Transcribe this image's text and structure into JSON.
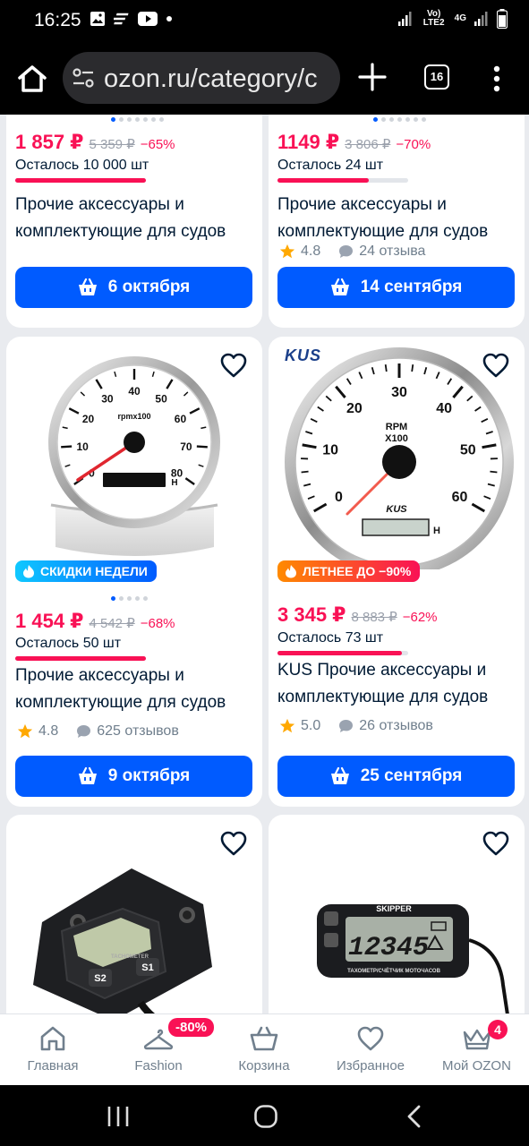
{
  "status": {
    "time": "16:25",
    "network": "Vo) LTE2",
    "network_gen": "4G",
    "battery": "battery-icon"
  },
  "browser": {
    "url": "ozon.ru/category/c",
    "tab_count": "16"
  },
  "products": [
    {
      "price": "1 857 ₽",
      "old_price": "5 359 ₽",
      "discount": "−65%",
      "stock_text": "Осталось 10 000 шт",
      "stock_level": 1.0,
      "title": "Прочие аксессуары и комплектующие для судов",
      "rating": "",
      "reviews": "",
      "delivery": "6 октября"
    },
    {
      "price": "1149 ₽",
      "old_price": "3 806 ₽",
      "discount": "−70%",
      "stock_text": "Осталось 24 шт",
      "stock_level": 0.7,
      "title": "Прочие аксессуары и комплектующие для судов",
      "rating": "4.8",
      "reviews": "24 отзыва",
      "delivery": "14 сентября"
    },
    {
      "promo": "СКИДКИ НЕДЕЛИ",
      "price": "1 454 ₽",
      "old_price": "4 542 ₽",
      "discount": "−68%",
      "stock_text": "Осталось 50 шт",
      "stock_level": 1.0,
      "title": "Прочие аксессуары и комплектующие для судов",
      "rating": "4.8",
      "reviews": "625 отзывов",
      "delivery": "9 октября",
      "gauge": {
        "labels": [
          "0",
          "10",
          "20",
          "30",
          "40",
          "50",
          "60",
          "70",
          "80"
        ],
        "unit": "rpmx100",
        "hour": "H"
      }
    },
    {
      "brand": "KUS",
      "promo": "ЛЕТНЕЕ ДО −90%",
      "price": "3 345 ₽",
      "old_price": "8 883 ₽",
      "discount": "−62%",
      "stock_text": "Осталось 73 шт",
      "stock_level": 0.95,
      "title": "KUS Прочие аксессуары и комплектующие для судов",
      "rating": "5.0",
      "reviews": "26 отзывов",
      "delivery": "25 сентября",
      "gauge": {
        "labels": [
          "0",
          "10",
          "20",
          "30",
          "40",
          "50",
          "60"
        ],
        "unit1": "RPM",
        "unit2": "X100",
        "brand": "KUS",
        "hour": "H"
      }
    },
    {
      "device_labels": [
        "S2",
        "S1"
      ],
      "device_text": "TACHOMETER"
    },
    {
      "device_brand": "SKIPPER",
      "device_reading": "12345",
      "device_caption": "ТАХОМЕТР/СЧЁТЧИК МОТОЧАСОВ"
    }
  ],
  "nav": {
    "home": "Главная",
    "fashion": "Fashion",
    "fashion_badge": "-80%",
    "cart": "Корзина",
    "favorites": "Избранное",
    "my": "Мой OZON",
    "my_badge": "4"
  },
  "colors": {
    "brand_blue": "#005bff",
    "price_red": "#f91155"
  }
}
